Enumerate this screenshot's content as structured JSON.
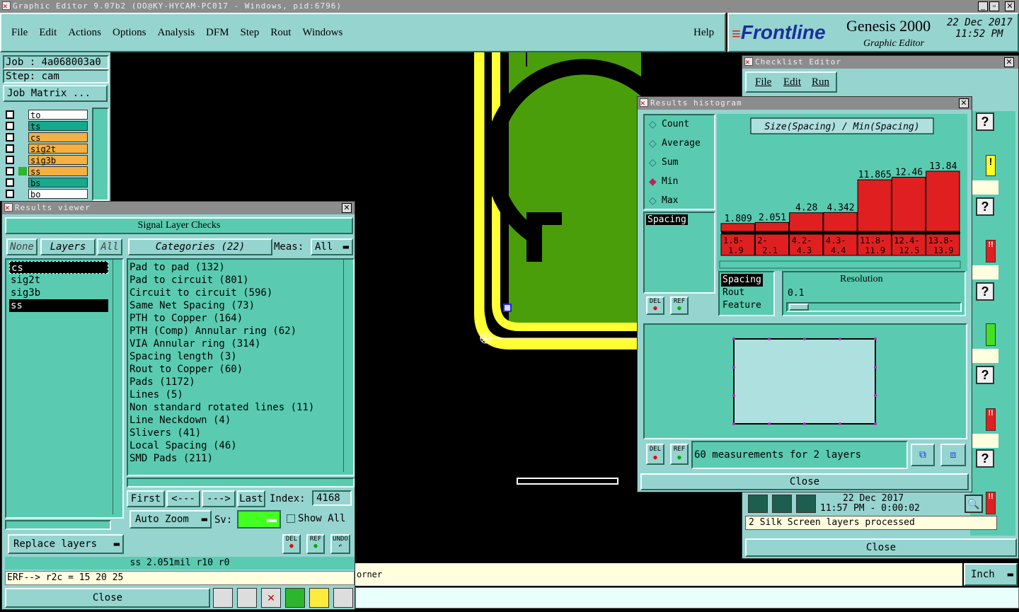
{
  "app": {
    "title": "Graphic Editor 9.07b2 (OO@KY-HYCAM-PC017 - Windows, pid:6796)",
    "menu": [
      "File",
      "Edit",
      "Actions",
      "Options",
      "Analysis",
      "DFM",
      "Step",
      "Rout",
      "Windows"
    ],
    "help": "Help",
    "brand": "Frontline",
    "product": "Genesis 2000",
    "subtitle": "Graphic Editor",
    "date": "22 Dec 2017",
    "time": "11:52 PM"
  },
  "job": {
    "job_label": "Job : 4a068003a0",
    "step_label": "Step: cam",
    "matrix_button": "Job Matrix ...",
    "layers": [
      {
        "name": "to",
        "color": "#ffffff"
      },
      {
        "name": "ts",
        "color": "#16a98e"
      },
      {
        "name": "cs",
        "color": "#f5b041"
      },
      {
        "name": "sig2t",
        "color": "#f5b041"
      },
      {
        "name": "sig3b",
        "color": "#f5b041"
      },
      {
        "name": "ss",
        "color": "#f5b041"
      },
      {
        "name": "bs",
        "color": "#16a98e"
      },
      {
        "name": "bo",
        "color": "#ffffff"
      }
    ]
  },
  "results_viewer": {
    "title": "Results viewer",
    "header": "Signal Layer Checks",
    "none_btn": "None",
    "layers_btn": "Layers",
    "all_btn": "All",
    "categories_btn": "Categories (22)",
    "meas_label": "Meas:",
    "meas_value": "All",
    "layers": [
      "cs",
      "sig2t",
      "sig3b",
      "ss"
    ],
    "categories": [
      "Pad to pad (132)",
      "Pad to circuit (801)",
      "Circuit to circuit (596)",
      "Same Net Spacing (73)",
      "PTH to Copper (164)",
      "PTH (Comp) Annular ring (62)",
      "VIA Annular ring (314)",
      "Spacing length (3)",
      "Rout to Copper (60)",
      "Pads (1172)",
      "Lines (5)",
      "Non standard rotated lines (11)",
      "Line Neckdown (4)",
      "Slivers (41)",
      "Local Spacing (46)",
      "SMD Pads (211)"
    ],
    "first": "First",
    "prev": "<---",
    "next": "--->",
    "last": "Last",
    "index_label": "Index:",
    "index_value": "4168",
    "auto_zoom": "Auto Zoom",
    "sv_label": "Sv:",
    "show_all": "Show All",
    "replace_layers": "Replace layers",
    "del": "DEL",
    "ref": "REF",
    "undo": "UNDO",
    "status": "ss 2.051mil  r10  r0",
    "close": "Close"
  },
  "command_line": "ERF--> r2c = 15 20 25",
  "bottom_bar": {
    "message": "orner",
    "units": "Inch"
  },
  "checklist": {
    "title": "Checklist Editor",
    "menu": [
      "File",
      "Edit",
      "Run"
    ],
    "run_time_date": "22 Dec 2017",
    "run_time": "11:57 PM - 0:00:02",
    "status": "2 Silk Screen layers processed",
    "close": "Close"
  },
  "histogram": {
    "title": "Results histogram",
    "options": [
      "Count",
      "Average",
      "Sum",
      "Min",
      "Max"
    ],
    "selected": "Min",
    "chart_title": "Size(Spacing) / Min(Spacing)",
    "list1": [
      "Spacing"
    ],
    "list2": [
      "Spacing",
      "Rout",
      "Feature"
    ],
    "resolution_label": "Resolution",
    "resolution_value": "0.1",
    "measurements": "60 measurements for 2 layers",
    "close": "Close",
    "del": "DEL",
    "ref": "REF"
  },
  "chart_data": {
    "type": "bar",
    "title": "Size(Spacing) / Min(Spacing)",
    "categories": [
      "1.8-1.9",
      "2-2.1",
      "4.2-4.3",
      "4.3-4.4",
      "11.8-11.9",
      "12.4-12.5",
      "13.8-13.9"
    ],
    "values": [
      1.809,
      2.051,
      4.28,
      4.342,
      11.865,
      12.46,
      13.84
    ],
    "value_labels": [
      "1.809",
      "2.051",
      "4.28",
      "4.342",
      "11.865",
      "12.46",
      "13.84"
    ],
    "ylim": [
      0,
      14
    ]
  },
  "colors": {
    "panel": "#5acbb0",
    "frame": "#96d4d0",
    "copper_yellow": "#ffff33",
    "fill_green": "#4a9e0a",
    "bar_red": "#e02020"
  }
}
